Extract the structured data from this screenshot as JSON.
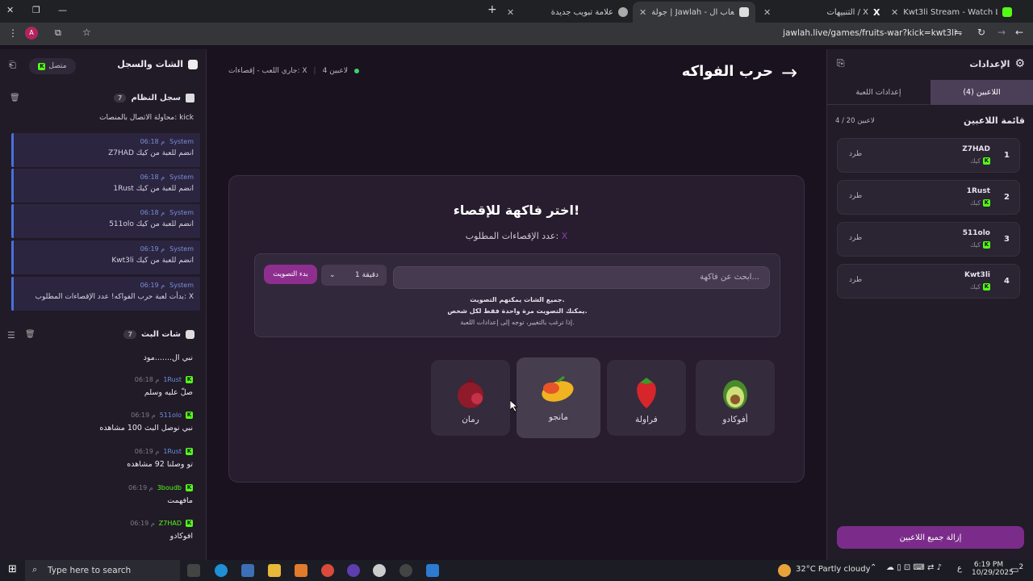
{
  "browser": {
    "tabs": [
      {
        "label": "Kwt3li Stream - Watch Live on K",
        "active": false
      },
      {
        "label": "التنبيهات / X",
        "active": false
      },
      {
        "label": "جولة | Jawlah - منصة الألعاب ال",
        "active": true
      },
      {
        "label": "علامة تبويب جديدة",
        "active": false
      }
    ],
    "url": "jawlah.live/games/fruits-war?kick=kwt3li",
    "profile_initial": "A"
  },
  "left_panel": {
    "title": "الشات والسجل",
    "connection_status": "متصل",
    "system_log": {
      "title": "سجل النظام",
      "count": "7",
      "first_partial": "محاولة الاتصال بالمنصات: kick",
      "entries": [
        {
          "user": "System",
          "time": "06:18 م",
          "text": "Z7HAD انضم للعبة من كيك"
        },
        {
          "user": "System",
          "time": "06:18 م",
          "text": "1Rust انضم للعبة من كيك"
        },
        {
          "user": "System",
          "time": "06:18 م",
          "text": "511olo انضم للعبة من كيك"
        },
        {
          "user": "System",
          "time": "06:19 م",
          "text": "Kwt3li انضم للعبة من كيك"
        },
        {
          "user": "System",
          "time": "06:19 م",
          "text": "بدأت لعبة حرب الفواكه! عدد الإقصاءات المطلوب: X"
        }
      ]
    },
    "live_chat": {
      "title": "شات البث",
      "count": "7",
      "first_partial": "نبي ال.......مود",
      "messages": [
        {
          "user": "1Rust",
          "time": "06:18 م",
          "text": "صلّ عليه وسلم"
        },
        {
          "user": "511olo",
          "time": "06:19 م",
          "text": "نبي نوصل البث 100 مشاهده"
        },
        {
          "user": "1Rust",
          "time": "06:19 م",
          "text": "تو وصلنا 92 مشاهده"
        },
        {
          "user": "3boudb",
          "time": "06:19 م",
          "text": "مافهمت"
        },
        {
          "user": "Z7HAD",
          "time": "06:19 م",
          "text": "افوكادو"
        }
      ]
    }
  },
  "game": {
    "title": "حرب الفواكه",
    "players_count": "4 لاعبين",
    "status": "جاري اللعب - إقصاءات: X",
    "heading": "اختر فاكهة للإقصاء!",
    "eliminations_label": "عدد الإقصاءات المطلوب:",
    "eliminations_value": "X",
    "search_placeholder": "ابحث عن فاكهة...",
    "duration": "1 دقيقة",
    "start_vote": "بدء التصويت",
    "note1": "جميع الشات يمكنهم التصويت.",
    "note2": "يمكنك التصويت مرة واحدة فقط لكل شخص.",
    "note3": "إذا ترغب بالتغيير، توجه إلى إعدادات اللعبة.",
    "fruits": [
      {
        "name": "أفوكادو",
        "icon": "avocado-icon"
      },
      {
        "name": "فراولة",
        "icon": "strawberry-icon"
      },
      {
        "name": "مانجو",
        "icon": "mango-icon",
        "selected": true
      },
      {
        "name": "رمان",
        "icon": "pomegranate-icon"
      }
    ]
  },
  "right_panel": {
    "title": "الإعدادات",
    "tabs": [
      "اللاعبين (4)",
      "إعدادات اللعبة"
    ],
    "list_title": "قائمة اللاعبين",
    "capacity": "4 / 20 لاعبين",
    "platform": "كيك",
    "kick_label": "طرد",
    "players": [
      {
        "num": "1",
        "name": "Z7HAD"
      },
      {
        "num": "2",
        "name": "1Rust"
      },
      {
        "num": "3",
        "name": "511olo"
      },
      {
        "num": "4",
        "name": "Kwt3li"
      }
    ],
    "remove_all": "إزالة جميع اللاعبين"
  },
  "taskbar": {
    "search_placeholder": "Type here to search",
    "weather": "32°C  Partly cloudy",
    "time": "6:19 PM",
    "date": "10/29/2025",
    "lang": "ع",
    "notifications": "2"
  },
  "colors": {
    "accent": "#8e2f8f",
    "kick_green": "#53fc18",
    "system_blue": "#4a6fd8"
  }
}
